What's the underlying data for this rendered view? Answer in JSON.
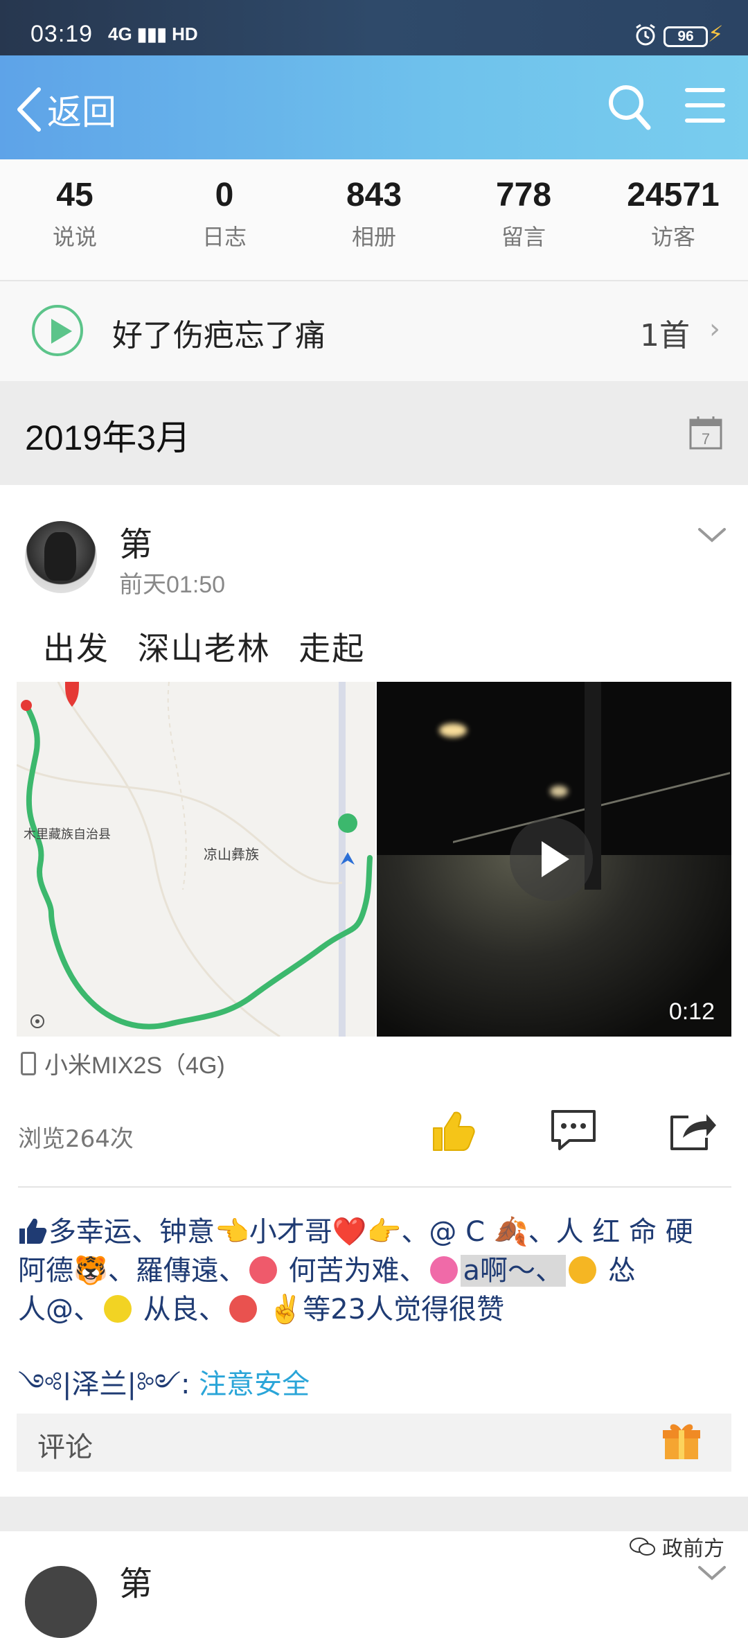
{
  "status_bar": {
    "time": "03:19",
    "network": "4G",
    "hd": "HD",
    "battery": "96"
  },
  "nav": {
    "back_label": "返回",
    "icons": [
      "search-icon",
      "menu-icon"
    ]
  },
  "stats": [
    {
      "num": "45",
      "label": "说说"
    },
    {
      "num": "0",
      "label": "日志"
    },
    {
      "num": "843",
      "label": "相册"
    },
    {
      "num": "778",
      "label": "留言"
    },
    {
      "num": "24571",
      "label": "访客"
    }
  ],
  "music": {
    "title": "好了伤疤忘了痛",
    "count": "1首"
  },
  "date_header": {
    "label": "2019年3月",
    "calendar_day": "7"
  },
  "post": {
    "user": "第",
    "time": "前天01:50",
    "text": "出发 深山老林 走起",
    "video_duration": "0:12",
    "device": "小米MIX2S（4G)",
    "views": "浏览264次",
    "likes": {
      "line1": "多幸运、钟意👈小才哥❤️👉、@ C 🍂、人 红 命 硬",
      "line2_a": "阿德🐯、羅傳遠、",
      "line2_b": " 何苦为难、",
      "line2_c": "a啊～、",
      "line2_d": " 怂",
      "line3_a": "人@、",
      "line3_b": " 从良、",
      "line3_c": " ✌️等23人觉得很赞"
    },
    "comment": {
      "author": "༺|泽兰|༻",
      "sep": ":",
      "text": "注意安全"
    },
    "comment_placeholder": "评论"
  },
  "next_post": {
    "user": "第"
  },
  "watermark": "政前方",
  "colors": {
    "accent_blue": "#5ea3e8",
    "link_blue": "#2aa5d8",
    "name_blue": "#1f3b73",
    "like_yellow": "#f5c518",
    "play_green": "#5cc48a"
  }
}
